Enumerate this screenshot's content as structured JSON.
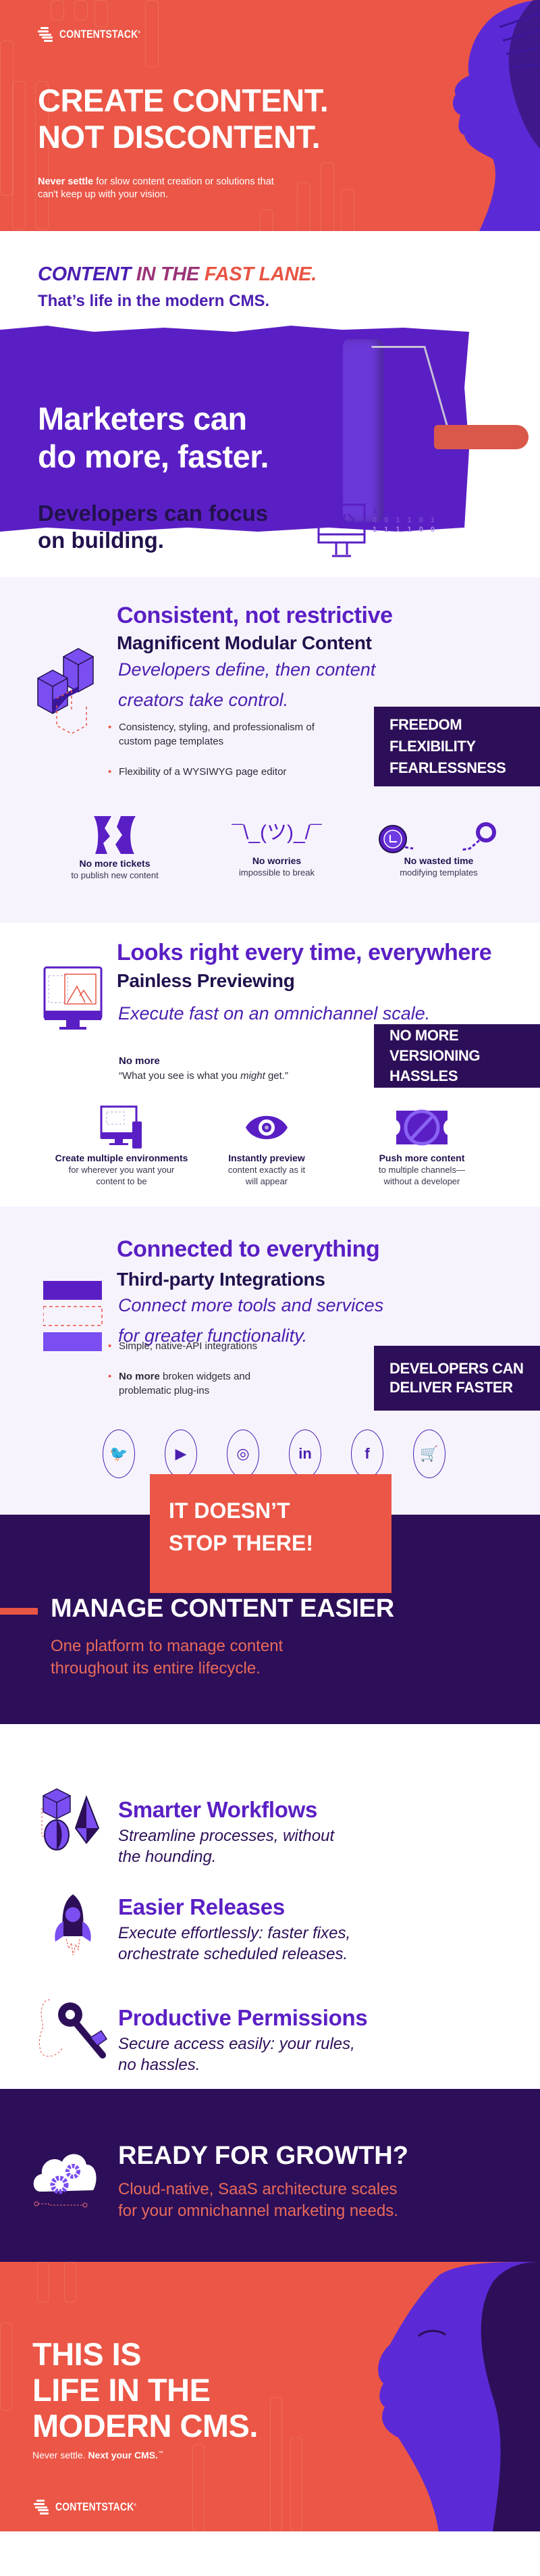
{
  "brand": {
    "name": "CONTENTSTACK",
    "registered": "®"
  },
  "colors": {
    "coral": "#eb5646",
    "purple": "#5a1fc4",
    "deep_purple": "#2d0f59",
    "lavender_bg": "#f7f3fd",
    "ink": "#22114d"
  },
  "hero": {
    "title_line1": "CREATE CONTENT.",
    "title_line2": "NOT DISCONTENT.",
    "sub_bold": "Never settle",
    "sub_rest": " for slow content creation or solutions that can't keep up with your vision."
  },
  "fast_lane": {
    "title_a": "CONTENT ",
    "title_b": "IN THE ",
    "title_c": "FAST LANE.",
    "subtitle": "That’s life in the modern CMS.",
    "marketers_line1": "Marketers can",
    "marketers_line2": "do more, faster.",
    "developers_line1": "Developers can focus",
    "developers_line2": "on building.",
    "binary_rows": [
      "1 0 1 0 1 0",
      "0 0 1 1 0 1",
      "1 1 1 1 0 0"
    ]
  },
  "sections": [
    {
      "heading": "Consistent, not restrictive",
      "subheading": "Magnificent Modular Content",
      "lede_line1": "Developers define, then content",
      "lede_line2": "creators take control.",
      "bullets": [
        {
          "bold": "",
          "text": "Consistency, styling, and professionalism of custom page templates"
        },
        {
          "bold": "",
          "text": "Flexibility of a WYSIWYG page editor"
        }
      ],
      "callout": [
        "FREEDOM",
        "FLEXIBILITY",
        "FEARLESSNESS"
      ],
      "features": [
        {
          "icon": "torn-ticket-icon",
          "key": "No more tickets",
          "value": "to publish new content"
        },
        {
          "icon": "shrug-icon",
          "glyph": "¯\\_(ツ)_/¯",
          "key": "No worries",
          "value": "impossible to break"
        },
        {
          "icon": "clock-handcuff-icon",
          "key": "No wasted time",
          "value": "modifying templates"
        }
      ]
    },
    {
      "heading": "Looks right every time, everywhere",
      "subheading": "Painless Previewing",
      "lede_line1": "Execute fast on an omnichannel scale.",
      "no_more_label": "No more",
      "no_more_quote_a": "“What you see is what you ",
      "no_more_quote_em": "might",
      "no_more_quote_b": " get.”",
      "callout": [
        "NO MORE",
        "VERSIONING",
        "HASSLES"
      ],
      "features": [
        {
          "icon": "devices-icon",
          "key": "Create multiple environments",
          "value": "for wherever you want your content to be"
        },
        {
          "icon": "eye-icon",
          "key": "Instantly preview",
          "value": "content exactly as it will appear"
        },
        {
          "icon": "no-ticket-icon",
          "key": "Push more content",
          "value": "to multiple channels—without a developer"
        }
      ]
    },
    {
      "heading": "Connected to everything",
      "subheading": "Third-party Integrations",
      "lede_line1": "Connect more tools and services",
      "lede_line2": "for greater functionality.",
      "bullets": [
        {
          "bold": "",
          "text": "Simple, native-API integrations"
        },
        {
          "bold": "No more",
          "text": " broken widgets and problematic plug-ins"
        }
      ],
      "callout": [
        "DEVELOPERS CAN",
        "DELIVER FASTER"
      ],
      "integrations": [
        {
          "name": "twitter",
          "glyph": "🐦"
        },
        {
          "name": "youtube",
          "glyph": "▶"
        },
        {
          "name": "instagram",
          "glyph": "◎"
        },
        {
          "name": "linkedin",
          "glyph": "in"
        },
        {
          "name": "facebook",
          "glyph": "f"
        },
        {
          "name": "cart",
          "glyph": "🛒"
        }
      ]
    }
  ],
  "more": {
    "badge_line1": "IT DOESN’T",
    "badge_line2": "STOP THERE!",
    "title": "MANAGE CONTENT EASIER",
    "subtitle_line1": "One platform to manage content",
    "subtitle_line2": "throughout its entire lifecycle."
  },
  "workflows": [
    {
      "icon": "shapes-icon",
      "title": "Smarter Workflows",
      "line1": "Streamline processes, without",
      "line2": "the hounding."
    },
    {
      "icon": "rocket-icon",
      "title": "Easier Releases",
      "line1": "Execute effortlessly: faster fixes,",
      "line2": "orchestrate scheduled releases."
    },
    {
      "icon": "key-icon",
      "title": "Productive Permissions",
      "line1": "Secure access easily: your rules,",
      "line2": "no hassles."
    }
  ],
  "growth": {
    "title": "READY FOR GROWTH?",
    "line1": "Cloud-native, SaaS architecture scales",
    "line2": "for your omnichannel marketing needs."
  },
  "footer": {
    "line1": "THIS IS",
    "line2": "LIFE IN THE",
    "line3": "MODERN CMS.",
    "tag_plain": "Never settle. ",
    "tag_bold": "Next your CMS.",
    "tag_tm": "™"
  }
}
